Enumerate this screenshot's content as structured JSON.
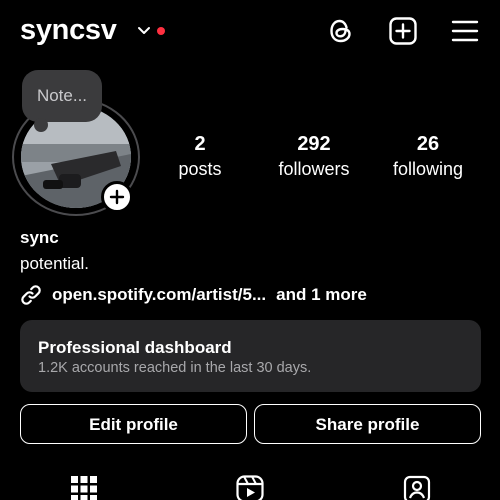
{
  "header": {
    "username": "syncsv",
    "icons": [
      "chevron-down-icon",
      "notification-dot",
      "threads-icon",
      "create-plus-icon",
      "menu-icon"
    ],
    "dot_color": "#ff3040"
  },
  "note": {
    "placeholder": "Note..."
  },
  "stats": [
    {
      "value": "2",
      "label": "posts"
    },
    {
      "value": "292",
      "label": "followers"
    },
    {
      "value": "26",
      "label": "following"
    }
  ],
  "profile": {
    "name": "sync",
    "bio": "potential.",
    "link": "open.spotify.com/artist/5...",
    "link_more": "and 1 more"
  },
  "dashboard": {
    "title": "Professional dashboard",
    "subtitle": "1.2K accounts reached in the last 30 days."
  },
  "buttons": {
    "edit": "Edit profile",
    "share": "Share profile"
  },
  "tabs": [
    "grid-icon",
    "reels-icon",
    "tagged-icon"
  ]
}
